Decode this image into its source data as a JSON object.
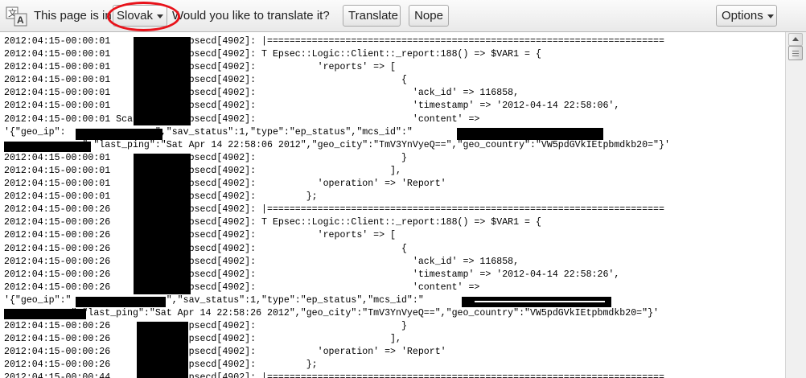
{
  "translate_bar": {
    "message_before": "This page is in",
    "language": "Slovak",
    "message_after": "Would you like to translate it?",
    "translate_label": "Translate",
    "nope_label": "Nope",
    "options_label": "Options"
  },
  "log": {
    "lines": [
      "2012:04:15-00:00:01             epsecd[4902]: |=======================================================================",
      "2012:04:15-00:00:01             epsecd[4902]: T Epsec::Logic::Client::_report:188() => $VAR1 = {",
      "2012:04:15-00:00:01             epsecd[4902]:           'reports' => [",
      "2012:04:15-00:00:01             epsecd[4902]:                          {",
      "2012:04:15-00:00:01             epsecd[4902]:                            'ack_id' => 116858,",
      "2012:04:15-00:00:01             epsecd[4902]:                            'timestamp' => '2012-04-14 22:58:06',",
      "2012:04:15-00:00:01 Scattman    epsecd[4902]:                            'content' =>",
      "'{\"geo_ip\":                \",\"sav_status\":1,\"type\":\"ep_status\",\"mcs_id\":\"                     -",
      "              \",\"last_ping\":\"Sat Apr 14 22:58:06 2012\",\"geo_city\":\"TmV3YnVyeQ==\",\"geo_country\":\"VW5pdGVkIEtpbmdkb20=\"}'",
      "2012:04:15-00:00:01             epsecd[4902]:                          }",
      "2012:04:15-00:00:01             epsecd[4902]:                        ],",
      "2012:04:15-00:00:01             epsecd[4902]:           'operation' => 'Report'",
      "2012:04:15-00:00:01             epsecd[4902]:         };",
      "2012:04:15-00:00:26             epsecd[4902]: |=======================================================================",
      "2012:04:15-00:00:26             epsecd[4902]: T Epsec::Logic::Client::_report:188() => $VAR1 = {",
      "2012:04:15-00:00:26             epsecd[4902]:           'reports' => [",
      "2012:04:15-00:00:26             epsecd[4902]:                          {",
      "2012:04:15-00:00:26             epsecd[4902]:                            'ack_id' => 116858,",
      "2012:04:15-00:00:26             epsecd[4902]:                            'timestamp' => '2012-04-14 22:58:26',",
      "2012:04:15-00:00:26             epsecd[4902]:                            'content' =>",
      "'{\"geo_ip\":\"                 \",\"sav_status\":1,\"type\":\"ep_status\",\"mcs_id\":\"",
      "            \",\"last_ping\":\"Sat Apr 14 22:58:26 2012\",\"geo_city\":\"TmV3YnVyeQ==\",\"geo_country\":\"VW5pdGVkIEtpbmdkb20=\"}'",
      "2012:04:15-00:00:26             epsecd[4902]:                          }",
      "2012:04:15-00:00:26             epsecd[4902]:                        ],",
      "2012:04:15-00:00:26             epsecd[4902]:           'operation' => 'Report'",
      "2012:04:15-00:00:26             epsecd[4902]:         };",
      "2012:04:15-00:00:44             epsecd[4902]: |======================================================================="
    ]
  }
}
